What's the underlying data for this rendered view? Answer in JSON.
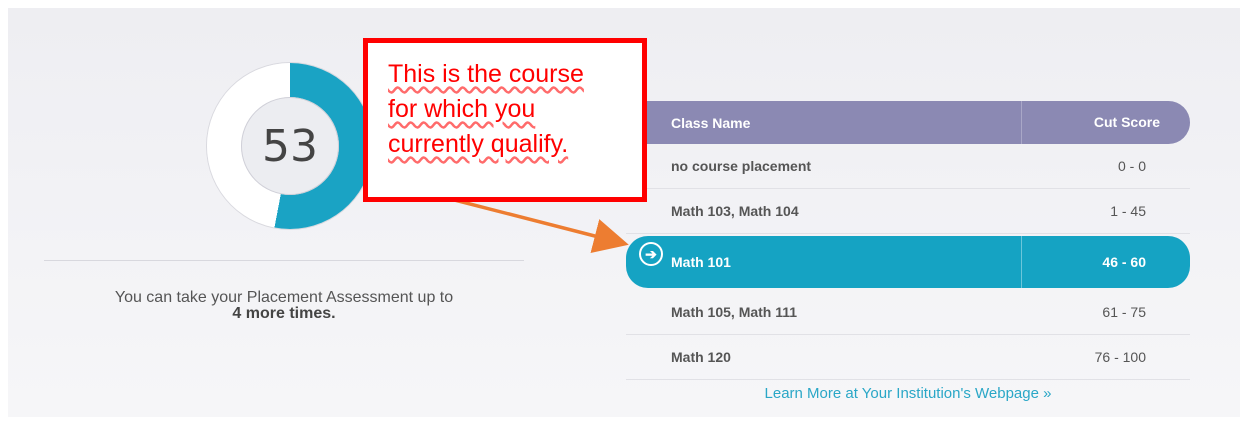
{
  "score": {
    "value": "53",
    "fill_fraction": 0.53,
    "accent_color": "#1aa3c4"
  },
  "attempts": {
    "line1": "You can take your Placement Assessment up to",
    "line2": "4 more times."
  },
  "table": {
    "header": {
      "name": "Class Name",
      "cut": "Cut Score"
    },
    "rows": [
      {
        "name": "no course placement",
        "cut": "0 - 0",
        "active": false
      },
      {
        "name": "Math 103, Math 104",
        "cut": "1 - 45",
        "active": false
      },
      {
        "name": "Math 101",
        "cut": "46 - 60",
        "active": true
      },
      {
        "name": "Math 105, Math 111",
        "cut": "61 - 75",
        "active": false
      },
      {
        "name": "Math 120",
        "cut": "76 - 100",
        "active": false
      }
    ],
    "header_color": "#8b89b3",
    "active_color": "#15a3c3",
    "active_icon": "arrow-right-circle-icon"
  },
  "learn_more": "Learn More at Your Institution's Webpage »",
  "callout": {
    "lines": [
      "This is the course",
      "for which you",
      "currently qualify."
    ],
    "border_color": "#ff0000",
    "arrow_color": "#ed7d31"
  }
}
